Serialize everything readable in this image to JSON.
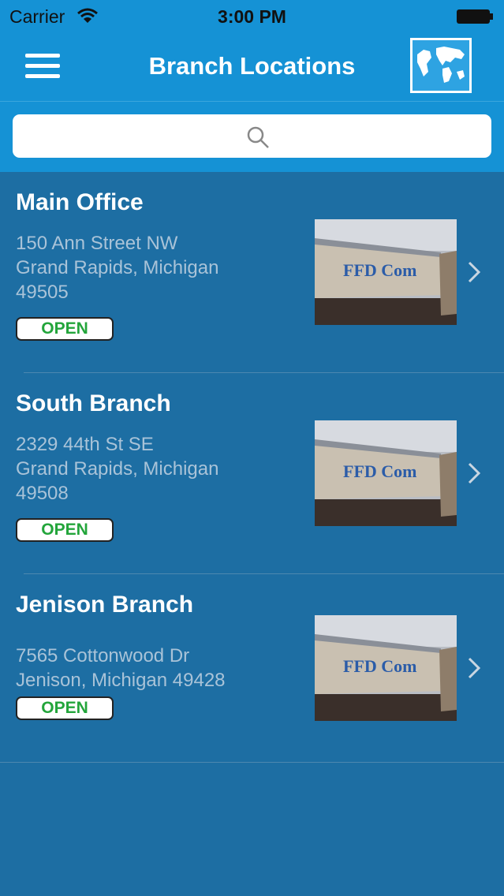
{
  "status_bar": {
    "carrier": "Carrier",
    "time": "3:00 PM"
  },
  "nav": {
    "title": "Branch Locations"
  },
  "search": {
    "placeholder": ""
  },
  "branches": [
    {
      "name": "Main Office",
      "address": [
        "150 Ann Street NW",
        "Grand Rapids, Michigan",
        "49505"
      ],
      "status": "OPEN",
      "photo_sign": "FFD Com"
    },
    {
      "name": "South Branch",
      "address": [
        "2329 44th St SE",
        "Grand Rapids, Michigan",
        "49508"
      ],
      "status": "OPEN",
      "photo_sign": "FFD Com"
    },
    {
      "name": "Jenison Branch",
      "address": [
        "7565 Cottonwood Dr",
        "Jenison, Michigan 49428"
      ],
      "status": "OPEN",
      "photo_sign": "FFD Com"
    }
  ],
  "colors": {
    "header": "#1592d5",
    "background": "#1d6ea3",
    "open_status": "#23a53b"
  },
  "icons": {
    "menu": "hamburger-icon",
    "map": "world-map-icon",
    "search": "magnifier-icon",
    "chevron": "chevron-right-icon"
  }
}
